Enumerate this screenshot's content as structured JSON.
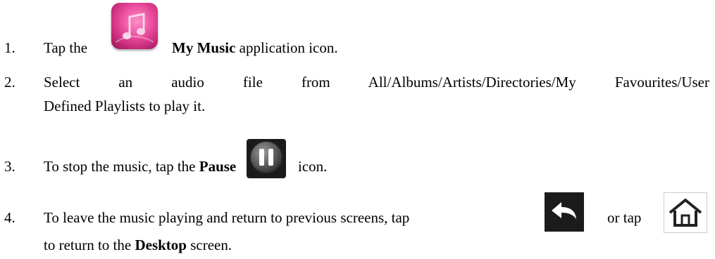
{
  "steps": [
    {
      "number": "1.",
      "text_before_icon": "Tap the",
      "bold": "My Music",
      "text_after_bold": "application icon.",
      "icon": "my-music-app-icon"
    },
    {
      "number": "2.",
      "line1": "Select an audio file from All/Albums/Artists/Directories/My Favourites/User",
      "line2": "Defined Playlists to play it."
    },
    {
      "number": "3.",
      "text_before_bold": "To stop the music, tap the",
      "bold": "Pause",
      "text_after_icon": "icon.",
      "icon": "pause-icon"
    },
    {
      "number": "4.",
      "line1_before_icon1": "To leave the music playing and return to previous screens, tap",
      "line1_between_icons": "or tap",
      "line2_before_bold": "to return to the",
      "bold": "Desktop",
      "line2_after_bold": "screen.",
      "icon1": "back-arrow-icon",
      "icon2": "home-icon"
    }
  ],
  "colors": {
    "text": "#000000",
    "music_icon_pink": "#e8489a",
    "icon_dark": "#1a1a1a"
  }
}
